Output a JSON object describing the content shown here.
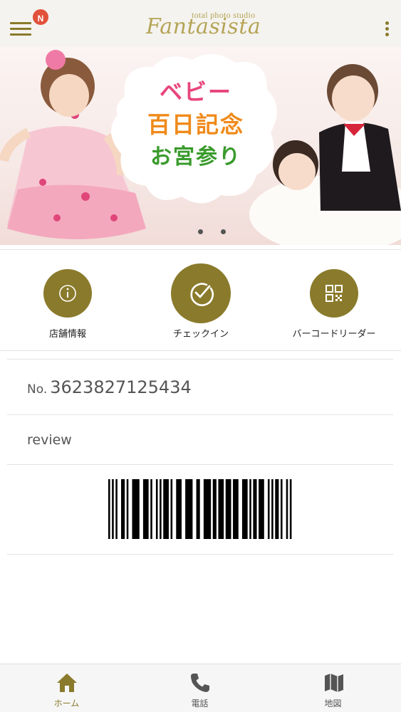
{
  "header": {
    "notification_badge": "N",
    "logo_subtitle": "total photo studio",
    "logo_name": "Fantasista",
    "accent_color": "#8a7a2b",
    "badge_color": "#e2513a"
  },
  "banner": {
    "line1": "ベビー",
    "line2": "百日記念",
    "line3": "お宮参り",
    "pages": 2
  },
  "actions": [
    {
      "label": "店舗情報",
      "icon": "info-icon"
    },
    {
      "label": "チェックイン",
      "icon": "check-icon"
    },
    {
      "label": "バーコードリーダー",
      "icon": "qr-code-icon"
    }
  ],
  "card": {
    "number_prefix": "No.",
    "number": "3623827125434",
    "review_label": "review"
  },
  "tabs": [
    {
      "label": "ホーム",
      "icon": "home-icon",
      "active": true
    },
    {
      "label": "電話",
      "icon": "phone-icon",
      "active": false
    },
    {
      "label": "地図",
      "icon": "map-icon",
      "active": false
    }
  ]
}
